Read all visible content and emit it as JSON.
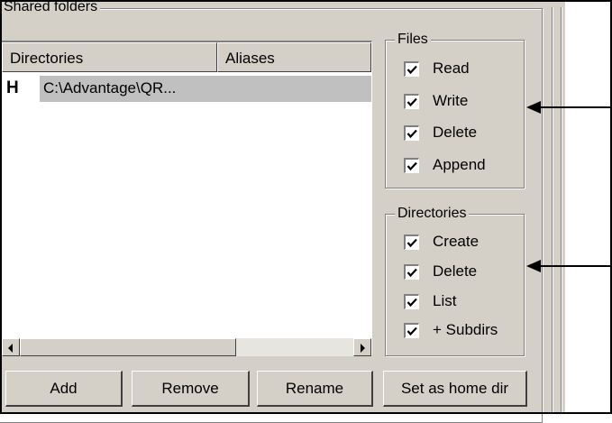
{
  "shared_folders": {
    "group_title": "Shared folders",
    "columns": [
      "Directories",
      "Aliases"
    ],
    "rows": [
      {
        "drive_key": "H",
        "path": "C:\\Advantage\\QR..."
      }
    ]
  },
  "files_group": {
    "title": "Files",
    "checkboxes": [
      {
        "label": "Read",
        "checked": true
      },
      {
        "label": "Write",
        "checked": true
      },
      {
        "label": "Delete",
        "checked": true
      },
      {
        "label": "Append",
        "checked": true
      }
    ]
  },
  "directories_group": {
    "title": "Directories",
    "checkboxes": [
      {
        "label": "Create",
        "checked": true
      },
      {
        "label": "Delete",
        "checked": true
      },
      {
        "label": "List",
        "checked": true
      },
      {
        "label": "+ Subdirs",
        "checked": true
      }
    ]
  },
  "buttons": {
    "add": "Add",
    "remove": "Remove",
    "rename": "Rename",
    "set_home": "Set as home dir"
  },
  "annotations": {
    "arrow_icon": "left-arrow-icon"
  }
}
